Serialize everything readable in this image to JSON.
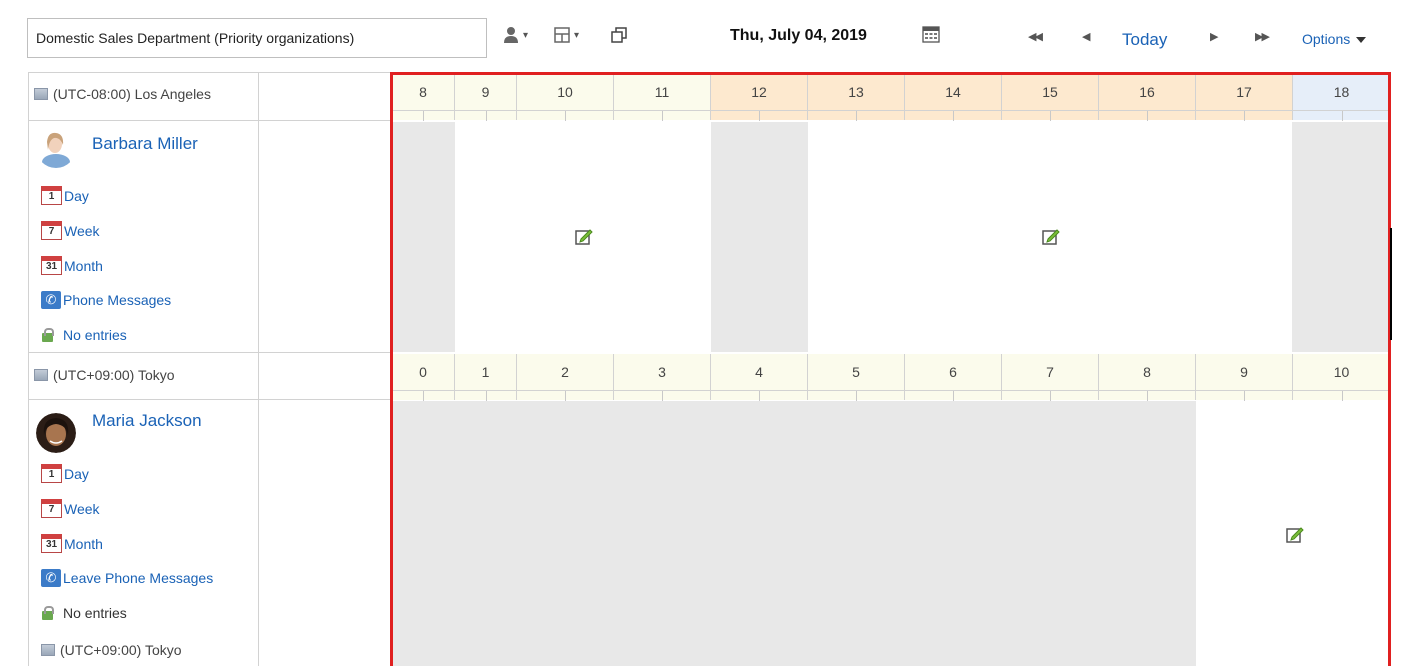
{
  "toolbar": {
    "group_select": "Domestic Sales Department (Priority organizations)",
    "date": "Thu, July 04, 2019",
    "today": "Today",
    "options": "Options",
    "icons": [
      "user-select-icon",
      "layout-select-icon",
      "open-window-icon",
      "calendar-icon",
      "first-icon",
      "prev-icon",
      "next-icon",
      "last-icon"
    ]
  },
  "timezones": {
    "la": "(UTC-08:00) Los Angeles",
    "tokyo": "(UTC+09:00) Tokyo",
    "tokyo2": "(UTC+09:00) Tokyo"
  },
  "hours_la": [
    "8",
    "9",
    "10",
    "11",
    "12",
    "13",
    "14",
    "15",
    "16",
    "17",
    "18"
  ],
  "hours_tokyo": [
    "0",
    "1",
    "2",
    "3",
    "4",
    "5",
    "6",
    "7",
    "8",
    "9",
    "10"
  ],
  "users": [
    {
      "name": "Barbara Miller",
      "links": {
        "day": "Day",
        "week": "Week",
        "month": "Month",
        "phone": "Phone Messages",
        "entries": "No entries"
      },
      "cal_numbers": {
        "day": "1",
        "week": "7",
        "month": "31"
      }
    },
    {
      "name": "Maria Jackson",
      "links": {
        "day": "Day",
        "week": "Week",
        "month": "Month",
        "phone": "Leave Phone Messages",
        "entries": "No entries"
      },
      "cal_numbers": {
        "day": "1",
        "week": "7",
        "month": "31"
      }
    }
  ],
  "colors": {
    "link": "#1a62b6",
    "highlight_frame": "#e02020",
    "off_hours": "#e8e8e8",
    "business_hours_header": "#fbfbec",
    "lunch_header": "#fde9cf",
    "after_hours_header": "#e6eef9"
  }
}
